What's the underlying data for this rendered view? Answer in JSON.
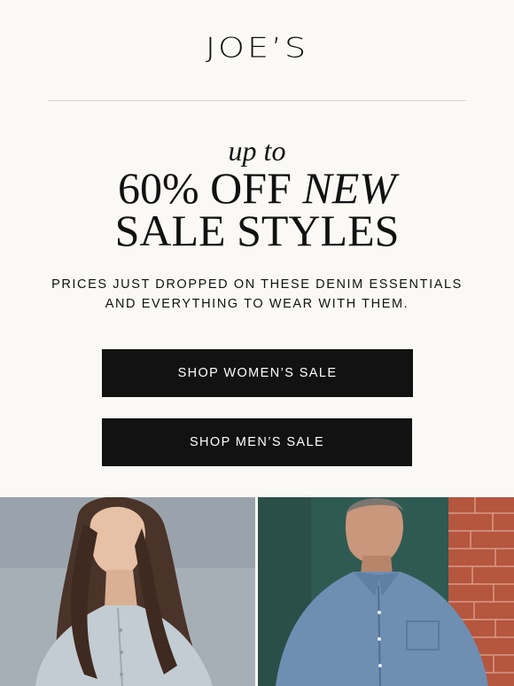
{
  "brand": {
    "logo_text": "JOE’S"
  },
  "hero": {
    "eyebrow": "up to",
    "headline_line1_regular": "60% OFF",
    "headline_line1_italic": "NEW",
    "headline_line2": "SALE STYLES",
    "subcopy_line1": "PRICES JUST DROPPED ON THESE DENIM ESSENTIALS",
    "subcopy_line2": "AND EVERYTHING TO WEAR WITH THEM."
  },
  "buttons": {
    "women_label": "SHOP WOMEN’S SALE",
    "men_label": "SHOP MEN’S SALE"
  },
  "colors": {
    "background": "#faf9f6",
    "button_bg": "#121212",
    "button_text": "#ffffff",
    "brick": "#b5563e",
    "denim": "#6e8fb2",
    "teal_wall": "#2f5a52"
  },
  "images": [
    {
      "name": "woman-model",
      "description": ""
    },
    {
      "name": "man-model",
      "description": ""
    }
  ]
}
